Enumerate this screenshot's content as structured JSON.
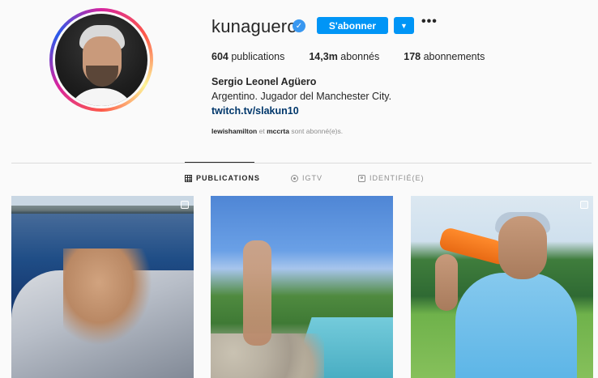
{
  "profile": {
    "username": "kunaguero",
    "verified": true,
    "follow_label": "S'abonner",
    "dropdown_label": "▼",
    "more_label": "•••",
    "stats": {
      "posts_count": "604",
      "posts_label": "publications",
      "followers_count": "14,3m",
      "followers_label": "abonnés",
      "following_count": "178",
      "following_label": "abonnements"
    },
    "full_name": "Sergio Leonel Agüero",
    "bio": "Argentino. Jugador del Manchester City.",
    "link": "twitch.tv/slakun10",
    "followed_by": {
      "user1": "lewishamilton",
      "conj": "et",
      "user2": "mccrta",
      "suffix": "sont abonné(e)s."
    }
  },
  "tabs": [
    {
      "label": "PUBLICATIONS",
      "active": true
    },
    {
      "label": "IGTV",
      "active": false
    },
    {
      "label": "IDENTIFIÉ(E)",
      "active": false
    }
  ],
  "colors": {
    "accent_blue": "#0095f6",
    "verified_blue": "#3897f0",
    "link_blue": "#00376b"
  },
  "posts": [
    {
      "multi": true
    },
    {
      "multi": false
    },
    {
      "multi": true
    }
  ]
}
